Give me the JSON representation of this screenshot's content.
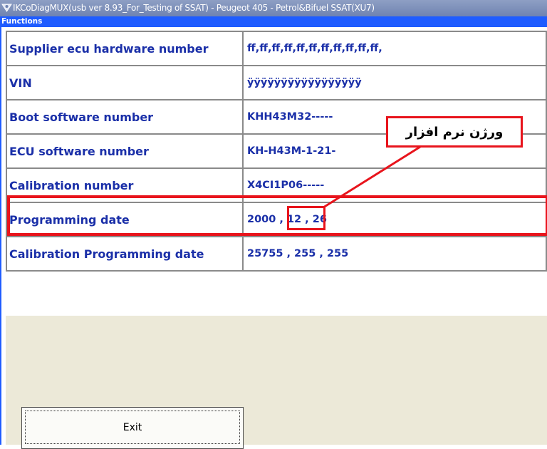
{
  "window": {
    "title": "IKCoDiagMUX(usb ver 8.93_For_Testing of SSAT)  - Peugeot 405 - Petrol&Bifuel SSAT(XU7)"
  },
  "menu": {
    "label": "Functions"
  },
  "rows": [
    {
      "label": "Supplier ecu hardware number",
      "value": "ff,ff,ff,ff,ff,ff,ff,ff,ff,ff,ff,"
    },
    {
      "label": "VIN",
      "value": "ÿÿÿÿÿÿÿÿÿÿÿÿÿÿÿÿÿ"
    },
    {
      "label": "Boot software number",
      "value": "KHH43M32-----"
    },
    {
      "label": "ECU software number",
      "value": "KH-H43M-1-21-"
    },
    {
      "label": "Calibration number",
      "value": "X4CI1P06-----"
    },
    {
      "label": "Programming date",
      "value": " 2000 , 12 , 26"
    },
    {
      "label": "Calibration Programming date",
      "value": " 25755 , 255 , 255"
    }
  ],
  "annotation": {
    "text": "ورژن نرم افزار",
    "color": "#e8141c"
  },
  "buttons": {
    "exit_label": "Exit"
  },
  "colors": {
    "label_text": "#1a2fa8",
    "menubar": "#1f5cff",
    "highlight": "#e8141c"
  }
}
